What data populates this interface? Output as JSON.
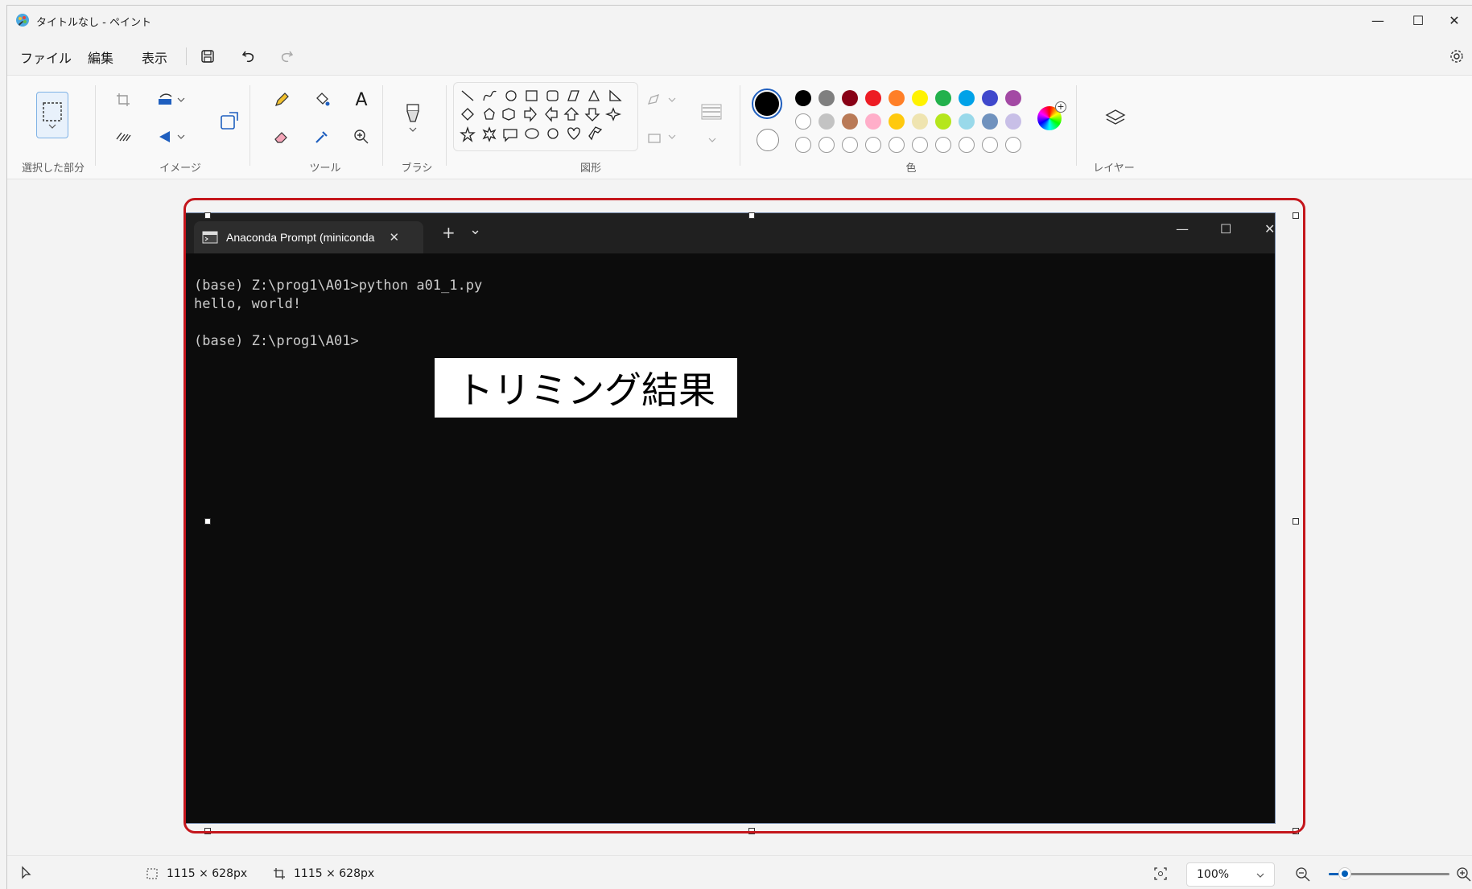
{
  "window": {
    "title": "タイトルなし - ペイント",
    "minimize": "—",
    "maximize": "☐",
    "close": "✕"
  },
  "menu": {
    "file": "ファイル",
    "edit": "編集",
    "view": "表示"
  },
  "ribbon": {
    "groups": {
      "selection": "選択した部分",
      "image": "イメージ",
      "tools": "ツール",
      "brush": "ブラシ",
      "shapes": "図形",
      "colors": "色",
      "layers": "レイヤー"
    },
    "text_tool": "A"
  },
  "colors": {
    "primary": "#000000",
    "secondary": "#ffffff",
    "row1": [
      "#000000",
      "#7f7f7f",
      "#880015",
      "#ed1c24",
      "#ff7f27",
      "#fff200",
      "#22b14c",
      "#00a2e8",
      "#3f48cc",
      "#a349a4"
    ],
    "row2": [
      "#ffffff",
      "#c3c3c3",
      "#b97a57",
      "#ffaec9",
      "#ffc90e",
      "#efe4b0",
      "#b5e61d",
      "#99d9ea",
      "#7092be",
      "#c8bfe7"
    ]
  },
  "terminal": {
    "tab_title": "Anaconda Prompt (miniconda",
    "new_tab": "+",
    "dropdown": "⌄",
    "lines": [
      "(base) Z:\\prog1\\A01>python a01_1.py",
      "hello, world!",
      "",
      "(base) Z:\\prog1\\A01>"
    ]
  },
  "caption": "トリミング結果",
  "status": {
    "selection_size": "1115 × 628px",
    "canvas_size": "1115 × 628px",
    "zoom": "100%",
    "zoom_level": 0.13
  }
}
